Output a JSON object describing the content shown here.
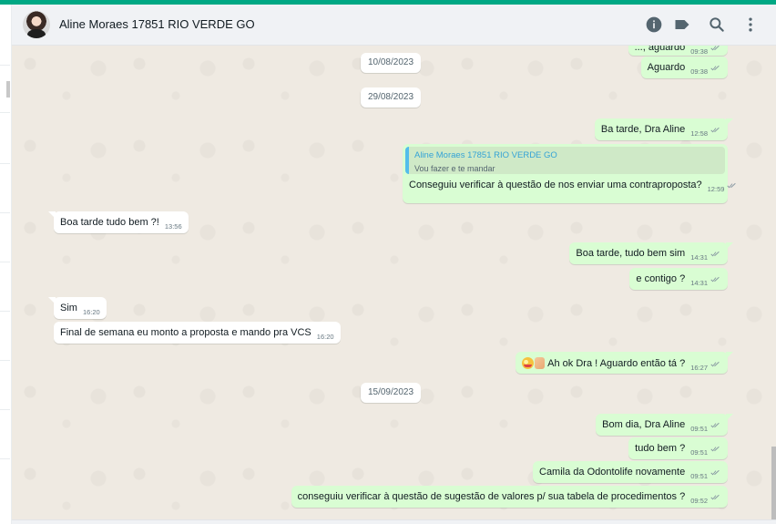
{
  "header": {
    "contact_name": "Aline Moraes 17851 RIO VERDE GO",
    "icons": [
      "info-icon",
      "label-icon",
      "search-icon",
      "menu-icon"
    ]
  },
  "colors": {
    "accent": "#00a884",
    "outgoing_bubble": "#d9fdd3",
    "incoming_bubble": "#ffffff",
    "chat_background": "#efeae2",
    "read_ticks": "#8696a0"
  },
  "chat": {
    "partial_top": {
      "text": "..., aguardo",
      "time": "09:38"
    },
    "msg_aguardo": {
      "text": "Aguardo",
      "time": "09:38"
    },
    "date_1": "10/08/2023",
    "date_2": "29/08/2023",
    "msg_ba_tarde": {
      "text": "Ba tarde, Dra Aline",
      "time": "12:58"
    },
    "msg_quote": {
      "quote_name": "Aline Moraes 17851 RIO VERDE GO",
      "quote_text": "Vou  fazer e te mandar",
      "text": "Conseguiu verificar à questão de nos enviar uma contraproposta?",
      "time": "12:59"
    },
    "msg_boa_tarde_in": {
      "text": "Boa tarde tudo bem ?!",
      "time": "13:56"
    },
    "msg_boa_tarde_out": {
      "text": "Boa tarde, tudo bem sim",
      "time": "14:31"
    },
    "msg_e_contigo": {
      "text": "e contigo ?",
      "time": "14:31"
    },
    "msg_sim": {
      "text": "Sim",
      "time": "16:20"
    },
    "msg_final_semana": {
      "text": "Final de semana eu monto a proposta e mando pra VCS",
      "time": "16:20"
    },
    "msg_ah_ok": {
      "text": "Ah ok Dra ! Aguardo então tá ?",
      "time": "16:27"
    },
    "date_3": "15/09/2023",
    "msg_bom_dia": {
      "text": "Bom dia, Dra Aline",
      "time": "09:51"
    },
    "msg_tudo_bem": {
      "text": "tudo bem ?",
      "time": "09:51"
    },
    "msg_camila": {
      "text": "Camila da Odontolife novamente",
      "time": "09:51"
    },
    "msg_conseguiu": {
      "text": "conseguiu verificar à questão de sugestão de valores p/ sua tabela de procedimentos ?",
      "time": "09:52"
    }
  }
}
